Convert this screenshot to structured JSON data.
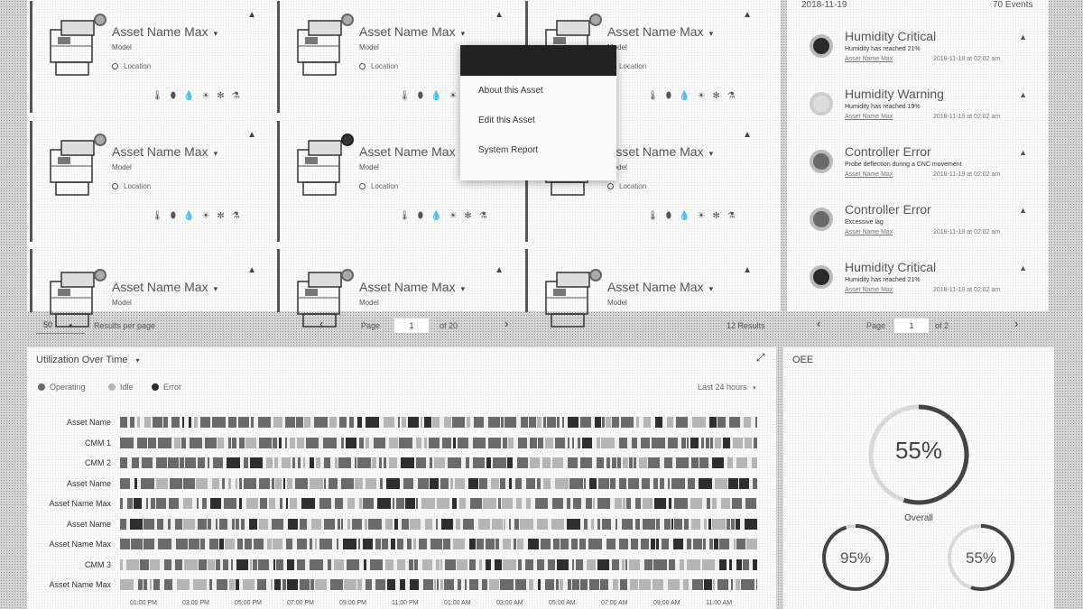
{
  "cards": [
    {
      "name": "Asset Name Max",
      "model": "Model",
      "location": "Location",
      "status": "light"
    },
    {
      "name": "Asset Name Max",
      "model": "Model",
      "location": "Location",
      "status": "light"
    },
    {
      "name": "Asset Name Max",
      "model": "Model",
      "location": "Location",
      "status": "light"
    },
    {
      "name": "Asset Name Max",
      "model": "Model",
      "location": "Location",
      "status": "light"
    },
    {
      "name": "Asset Name Max",
      "model": "Model",
      "location": "Location",
      "status": "dark"
    },
    {
      "name": "Asset Name Max",
      "model": "Model",
      "location": "Location",
      "status": "light"
    },
    {
      "name": "Asset Name Max",
      "model": "Model",
      "location": "",
      "status": "light"
    },
    {
      "name": "Asset Name Max",
      "model": "Model",
      "location": "",
      "status": "light"
    },
    {
      "name": "Asset Name Max",
      "model": "Model",
      "location": "",
      "status": "light"
    }
  ],
  "card_icons": [
    "thermometer-icon",
    "droplet-icon",
    "drop-icon",
    "sun-icon",
    "fan-icon",
    "flask-icon"
  ],
  "context_menu": {
    "items": [
      "About this Asset",
      "Edit this Asset",
      "System Report"
    ]
  },
  "asset_pager": {
    "per_page_value": "50",
    "per_page_label": "Results per page",
    "page_label": "Page",
    "page_value": "1",
    "of_label": "of 20",
    "results": "12 Results"
  },
  "events": {
    "date": "2018-11-19",
    "count": "70 Events",
    "items": [
      {
        "title": "Humidity Critical",
        "desc": "Humidity has reached 21%",
        "asset": "Asset Name Max",
        "time": "2018-11-19 at 02:02 am",
        "icon": "drop"
      },
      {
        "title": "Humidity Warning",
        "desc": "Humidity has reached 19%",
        "asset": "Asset Name Max",
        "time": "2018-11-19 at 02:02 am",
        "icon": "light"
      },
      {
        "title": "Controller Error",
        "desc": "Probe deflection during a CNC movement",
        "asset": "Asset Name Max",
        "time": "2018-11-19 at 02:02 am",
        "icon": "mid"
      },
      {
        "title": "Controller Error",
        "desc": "Excessive lag",
        "asset": "Asset Name Max",
        "time": "2018-11-19 at 02:02 am",
        "icon": "mid"
      },
      {
        "title": "Humidity Critical",
        "desc": "Humidity has reached 21%",
        "asset": "Asset Name Max",
        "time": "2018-11-19 at 02:02 am",
        "icon": "drop"
      }
    ],
    "pager": {
      "page_label": "Page",
      "page_value": "1",
      "of_label": "of 2"
    }
  },
  "utilization": {
    "title": "Utilization Over Time",
    "legend": [
      {
        "label": "Operating",
        "color": "#6a6a6a"
      },
      {
        "label": "Idle",
        "color": "#b5b5b5"
      },
      {
        "label": "Error",
        "color": "#2e2e2e"
      }
    ],
    "range": "Last 24 hours",
    "rows": [
      "Asset Name",
      "CMM 1",
      "CMM 2",
      "Asset Name",
      "Asset Name Max",
      "Asset Name",
      "Asset Name Max",
      "CMM 3",
      "Asset Name Max"
    ],
    "ticks": [
      "01:00 PM",
      "03:00 PM",
      "05:00 PM",
      "07:00 PM",
      "09:00 PM",
      "11:00 PM",
      "01:00 AM",
      "03:00 AM",
      "05:00 AM",
      "07:00 AM",
      "09:00 AM",
      "11:00 AM"
    ]
  },
  "oee": {
    "title": "OEE",
    "overall_value": 55,
    "overall_text": "55%",
    "overall_label": "Overall",
    "left_value": 95,
    "left_text": "95%",
    "right_value": 55,
    "right_text": "55%"
  }
}
